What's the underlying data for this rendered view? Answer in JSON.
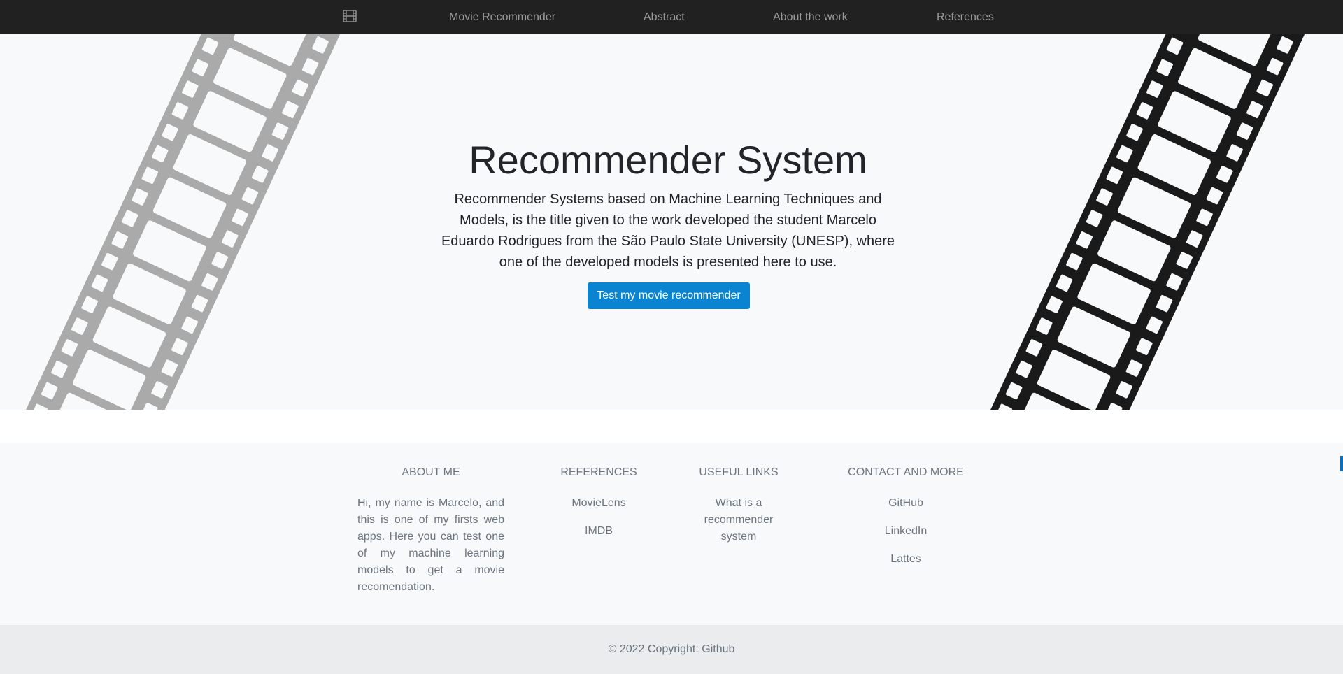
{
  "nav": {
    "brand_icon": "film-icon",
    "links": [
      "Movie Recommender",
      "Abstract",
      "About the work",
      "References"
    ]
  },
  "hero": {
    "title": "Recommender System",
    "description": "Recommender Systems based on Machine Learning Techniques and Models, is the title given to the work developed the student Marcelo Eduardo Rodrigues from the São Paulo State University (UNESP), where one of the developed models is presented here to use.",
    "button_label": "Test my movie recommender",
    "accent_color": "#0a84d0",
    "left_strip_color": "#a9aaa9",
    "right_strip_color": "#1a1a1a"
  },
  "footer": {
    "about": {
      "heading": "ABOUT ME",
      "text": "Hi, my name is Marcelo, and this is one of my firsts web apps. Here you can test one of my machine learning models to get a movie recomendation."
    },
    "references": {
      "heading": "REFERENCES",
      "links": [
        "MovieLens",
        "IMDB"
      ]
    },
    "useful": {
      "heading": "USEFUL LINKS",
      "links": [
        "What is a recommender system"
      ]
    },
    "contact": {
      "heading": "CONTACT AND MORE",
      "links": [
        "GitHub",
        "LinkedIn",
        "Lattes"
      ]
    }
  },
  "copyright": {
    "text": "© 2022 Copyright: ",
    "link": "Github"
  }
}
